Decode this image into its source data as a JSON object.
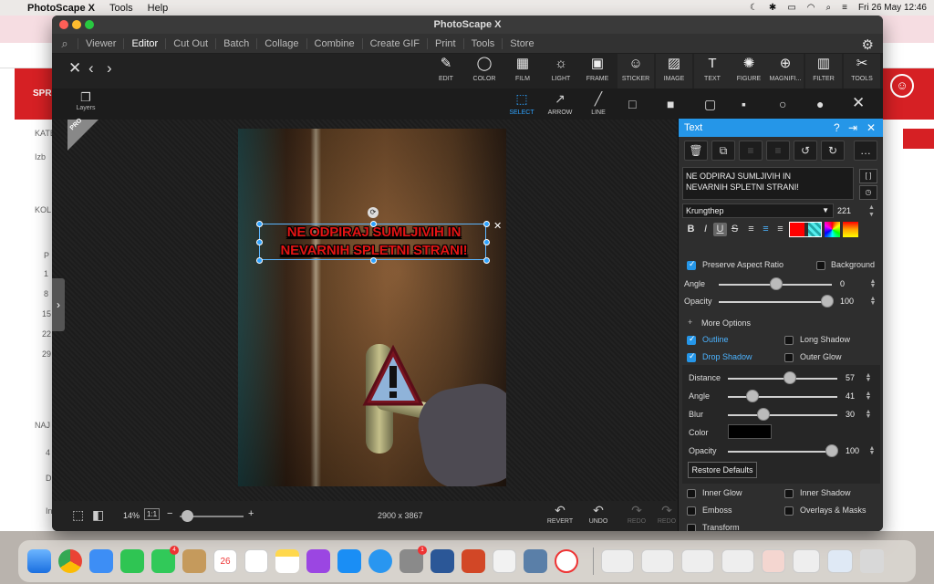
{
  "menubar": {
    "app": "PhotoScape X",
    "items": [
      "Tools",
      "Help"
    ],
    "datetime": "Fri 26 May  12:46"
  },
  "browser": {
    "red_label": "SPR",
    "ghost": [
      "KATE",
      "Izb",
      "KOL",
      "P",
      "1",
      "8",
      "15",
      "22",
      "29",
      "NAJ",
      "4",
      "D",
      "In"
    ],
    "help_icon": "accessibility-icon"
  },
  "window": {
    "title": "PhotoScape X"
  },
  "nav": {
    "items": [
      "Viewer",
      "Editor",
      "Cut Out",
      "Batch",
      "Collage",
      "Combine",
      "Create GIF",
      "Print",
      "Tools",
      "Store"
    ],
    "active": "Editor"
  },
  "toolbar": {
    "tools": [
      {
        "label": "EDIT",
        "icon": "edit-icon",
        "glyph": "✎"
      },
      {
        "label": "COLOR",
        "icon": "color-icon",
        "glyph": "◯"
      },
      {
        "label": "FILM",
        "icon": "film-icon",
        "glyph": "▦"
      },
      {
        "label": "LIGHT",
        "icon": "light-icon",
        "glyph": "☼"
      },
      {
        "label": "FRAME",
        "icon": "frame-icon",
        "glyph": "▣"
      },
      {
        "label": "STICKER",
        "icon": "sticker-icon",
        "glyph": "☺"
      },
      {
        "label": "IMAGE",
        "icon": "image-icon",
        "glyph": "▨"
      },
      {
        "label": "TEXT",
        "icon": "text-icon",
        "glyph": "T"
      },
      {
        "label": "FIGURE",
        "icon": "figure-icon",
        "glyph": "✺"
      },
      {
        "label": "MAGNIFI...",
        "icon": "magnifier-icon",
        "glyph": "⊕"
      },
      {
        "label": "FILTER",
        "icon": "filter-icon",
        "glyph": "▥"
      },
      {
        "label": "TOOLS",
        "icon": "tools-icon",
        "glyph": "✂"
      }
    ]
  },
  "subbar": {
    "layers": "Layers",
    "tools": [
      {
        "label": "SELECT",
        "active": true
      },
      {
        "label": "ARROW"
      },
      {
        "label": "LINE"
      }
    ]
  },
  "canvas": {
    "text_line1": "NE ODPIRAJ SUMLJIVIH IN",
    "text_line2": "NEVARNIH SPLETNI STRANI!",
    "pro": "PRO"
  },
  "status": {
    "zoom": "14%",
    "ratio": "1:1",
    "dimensions": "2900 x 3867",
    "actions": [
      "REVERT",
      "UNDO",
      "REDO",
      "REDO"
    ]
  },
  "panel": {
    "title": "Text",
    "text_value": "NE ODPIRAJ SUMLJIVIH IN\nNEVARNIH SPLETNI STRANI!",
    "font": "Krungthep",
    "size": "221",
    "preserve_aspect": "Preserve Aspect Ratio",
    "background": "Background",
    "angle_label": "Angle",
    "angle": "0",
    "opacity_label": "Opacity",
    "opacity": "100",
    "more_options": "More Options",
    "outline": "Outline",
    "long_shadow": "Long Shadow",
    "drop_shadow": "Drop Shadow",
    "outer_glow": "Outer Glow",
    "ds": {
      "distance_label": "Distance",
      "distance": "57",
      "angle_label": "Angle",
      "angle": "41",
      "blur_label": "Blur",
      "blur": "30",
      "color_label": "Color",
      "opacity_label": "Opacity",
      "opacity": "100"
    },
    "restore": "Restore Defaults",
    "inner_glow": "Inner Glow",
    "inner_shadow": "Inner Shadow",
    "emboss": "Emboss",
    "overlays": "Overlays & Masks",
    "transform": "Transform",
    "text_color": "#ff0000"
  }
}
